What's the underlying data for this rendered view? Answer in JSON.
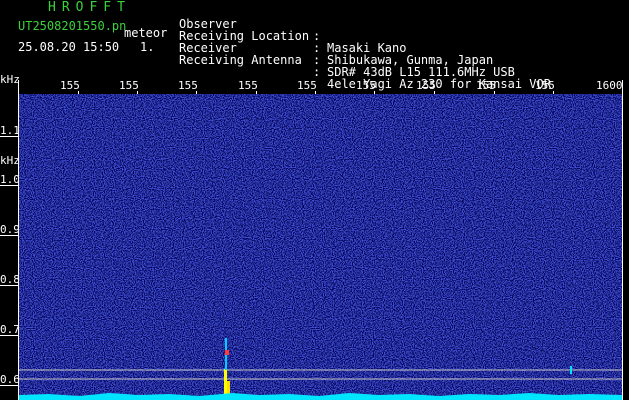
{
  "header": {
    "app_title": "HROFFT",
    "file_name": "UT2508201550.pn",
    "file_kind": "meteor",
    "date_time": "25.08.20 15:50",
    "frame_no": "1.",
    "info": [
      {
        "label": "Observer",
        "value": "Masaki Kano"
      },
      {
        "label": "Receiving Location",
        "value": "Shibukawa, Gunma, Japan"
      },
      {
        "label": "Receiver",
        "value": "SDR# 43dB L15 111.6MHz USB"
      },
      {
        "label": "Receiving Antenna",
        "value": "4ele Yagi Az 230 for Kansai VOR"
      }
    ],
    "separator": ":"
  },
  "axes": {
    "unit_top": "kHz",
    "unit_side": "kHz",
    "y_ticks": [
      "1.1",
      "1.0",
      "0.9",
      "0.8",
      "0.7",
      "0.6"
    ],
    "x_ticks": [
      "155",
      "155",
      "155",
      "155",
      "155",
      "155",
      "155",
      "155",
      "155",
      "1600"
    ]
  },
  "colors": {
    "background": "#000000",
    "noise_dark": "#00005a",
    "noise_bright": "#3a4aff",
    "meteor": "#ffff00",
    "baseline": "#00e5ff",
    "header_green": "#3cd23c"
  }
}
